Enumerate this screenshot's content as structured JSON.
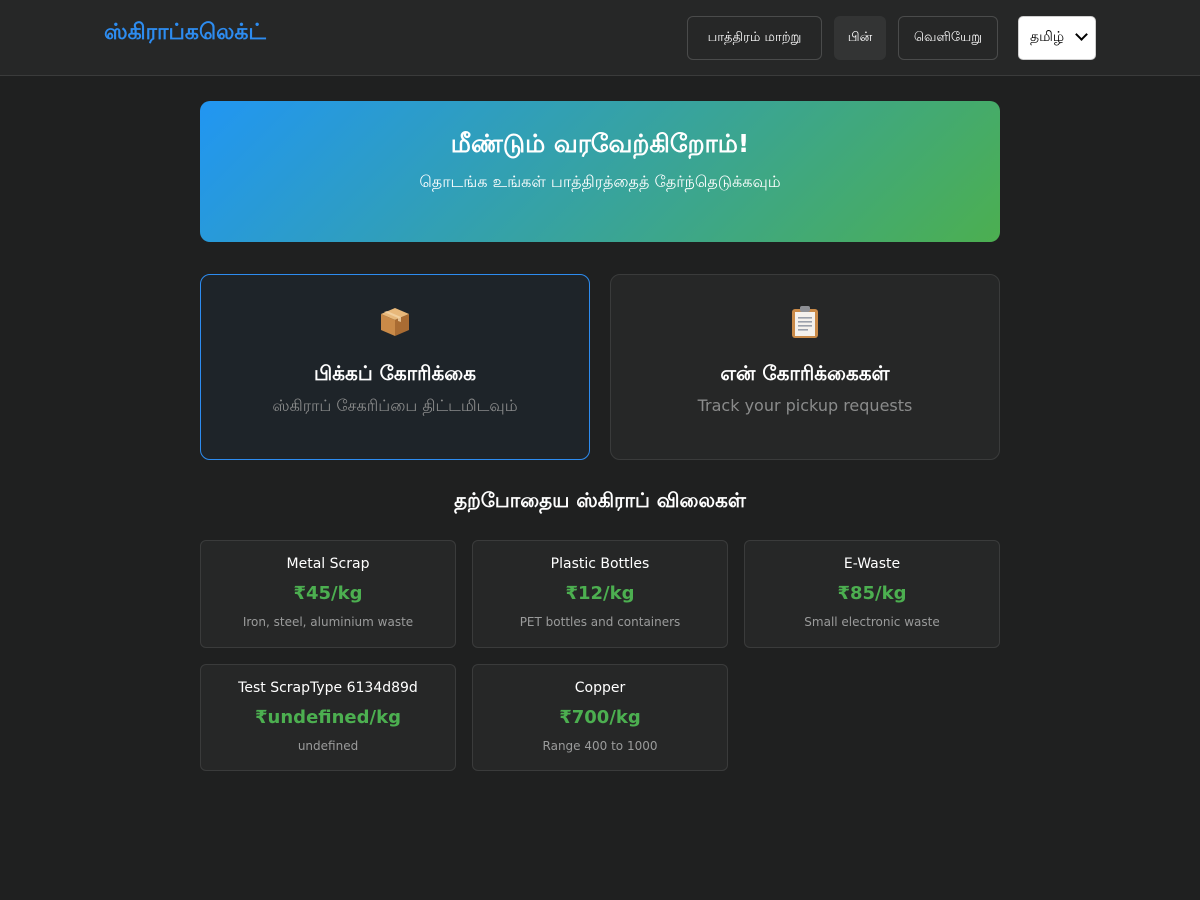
{
  "header": {
    "brand": "ஸ்கிராப்கலெக்ட்",
    "switch_role_label": "பாத்திரம் மாற்று",
    "back_label": "பின்",
    "logout_label": "வெளியேறு",
    "language_selected": "தமிழ்"
  },
  "hero": {
    "title": "மீண்டும் வரவேற்கிறோம்!",
    "subtitle": "தொடங்க உங்கள் பாத்திரத்தைத் தேர்ந்தெடுக்கவும்"
  },
  "actions": [
    {
      "icon": "package-box-icon",
      "title": "பிக்கப் கோரிக்கை",
      "subtitle": "ஸ்கிராப் சேகரிப்பை திட்டமிடவும்"
    },
    {
      "icon": "clipboard-icon",
      "title": "என் கோரிக்கைகள்",
      "subtitle": "Track your pickup requests"
    }
  ],
  "prices_section": {
    "title": "தற்போதைய ஸ்கிராப் விலைகள்",
    "items": [
      {
        "name": "Metal Scrap",
        "price": "₹45/kg",
        "description": "Iron, steel, aluminium waste"
      },
      {
        "name": "Plastic Bottles",
        "price": "₹12/kg",
        "description": "PET bottles and containers"
      },
      {
        "name": "E-Waste",
        "price": "₹85/kg",
        "description": "Small electronic waste"
      },
      {
        "name": "Test ScrapType 6134d89d",
        "price": "₹undefined/kg",
        "description": "undefined"
      },
      {
        "name": "Copper",
        "price": "₹700/kg",
        "description": "Range 400 to 1000"
      }
    ]
  },
  "colors": {
    "accent_blue": "#2d8cf0",
    "price_green": "#4caf50",
    "hero_gradient_start": "#2196f3",
    "hero_gradient_end": "#4caf50",
    "background": "#1f2020"
  }
}
